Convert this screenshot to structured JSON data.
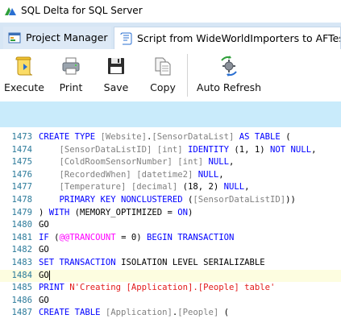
{
  "window": {
    "title": "SQL Delta for SQL Server"
  },
  "tabs": [
    {
      "label": "Project Manager",
      "icon": "project-manager-icon"
    },
    {
      "label": "Script from WideWorldImporters to AFTest",
      "icon": "script-icon"
    }
  ],
  "toolbar": {
    "execute": "Execute",
    "print": "Print",
    "save": "Save",
    "copy": "Copy",
    "auto_refresh": "Auto Refresh"
  },
  "colors": {
    "keyword": "#0000ff",
    "identifier": "#808080",
    "string": "#e21b1b",
    "function": "#ff00ff",
    "line_number": "#2b7a9a",
    "info_bar": "#c9ebfb",
    "current_line": "#fdfde0"
  },
  "editor": {
    "current_line": 1484,
    "lines": [
      {
        "num": "1473",
        "tokens": [
          [
            "kw",
            "CREATE TYPE "
          ],
          [
            "id",
            "[Website]"
          ],
          [
            "",
            "."
          ],
          [
            "id",
            "[SensorDataList]"
          ],
          [
            "kw",
            " AS TABLE "
          ],
          [
            "",
            "("
          ]
        ]
      },
      {
        "num": "1474",
        "tokens": [
          [
            "",
            "    "
          ],
          [
            "id",
            "[SensorDataListID]"
          ],
          [
            "",
            ""
          ],
          [
            "id",
            " [int]"
          ],
          [
            "kw",
            " IDENTITY "
          ],
          [
            "",
            "(1, 1) "
          ],
          [
            "kw",
            "NOT NULL"
          ],
          [
            "",
            ","
          ]
        ]
      },
      {
        "num": "1475",
        "tokens": [
          [
            "",
            "    "
          ],
          [
            "id",
            "[ColdRoomSensorNumber]"
          ],
          [
            "id",
            " [int]"
          ],
          [
            "kw",
            " NULL"
          ],
          [
            "",
            ","
          ]
        ]
      },
      {
        "num": "1476",
        "tokens": [
          [
            "",
            "    "
          ],
          [
            "id",
            "[RecordedWhen]"
          ],
          [
            "id",
            " [datetime2]"
          ],
          [
            "kw",
            " NULL"
          ],
          [
            "",
            ","
          ]
        ]
      },
      {
        "num": "1477",
        "tokens": [
          [
            "",
            "    "
          ],
          [
            "id",
            "[Temperature]"
          ],
          [
            "id",
            " [decimal]"
          ],
          [
            "",
            " (18, 2) "
          ],
          [
            "kw",
            "NULL"
          ],
          [
            "",
            ","
          ]
        ]
      },
      {
        "num": "1478",
        "tokens": [
          [
            "",
            "    "
          ],
          [
            "kw",
            "PRIMARY KEY NONCLUSTERED "
          ],
          [
            "",
            "("
          ],
          [
            "id",
            "[SensorDataListID]"
          ],
          [
            "",
            "))"
          ]
        ]
      },
      {
        "num": "1479",
        "tokens": [
          [
            "",
            ") "
          ],
          [
            "kw",
            "WITH "
          ],
          [
            "",
            "(MEMORY_OPTIMIZED = "
          ],
          [
            "kw",
            "ON"
          ],
          [
            "",
            ")"
          ]
        ]
      },
      {
        "num": "1480",
        "tokens": [
          [
            "",
            "GO"
          ]
        ]
      },
      {
        "num": "1481",
        "tokens": [
          [
            "kw",
            "IF "
          ],
          [
            "",
            "("
          ],
          [
            "fn",
            "@@TRANCOUNT"
          ],
          [
            "",
            " = 0) "
          ],
          [
            "kw",
            "BEGIN TRANSACTION"
          ]
        ]
      },
      {
        "num": "1482",
        "tokens": [
          [
            "",
            "GO"
          ]
        ]
      },
      {
        "num": "1483",
        "tokens": [
          [
            "kw",
            "SET TRANSACTION "
          ],
          [
            "",
            "ISOLATION LEVEL SERIALIZABLE"
          ]
        ]
      },
      {
        "num": "1484",
        "tokens": [
          [
            "",
            "GO"
          ]
        ]
      },
      {
        "num": "1485",
        "tokens": [
          [
            "kw",
            "PRINT "
          ],
          [
            "str",
            "N'Creating [Application].[People] table'"
          ]
        ]
      },
      {
        "num": "1486",
        "tokens": [
          [
            "",
            "GO"
          ]
        ]
      },
      {
        "num": "1487",
        "tokens": [
          [
            "kw",
            "CREATE TABLE "
          ],
          [
            "id",
            "[Application]"
          ],
          [
            "",
            "."
          ],
          [
            "id",
            "[People]"
          ],
          [
            "",
            " ("
          ]
        ]
      }
    ]
  }
}
